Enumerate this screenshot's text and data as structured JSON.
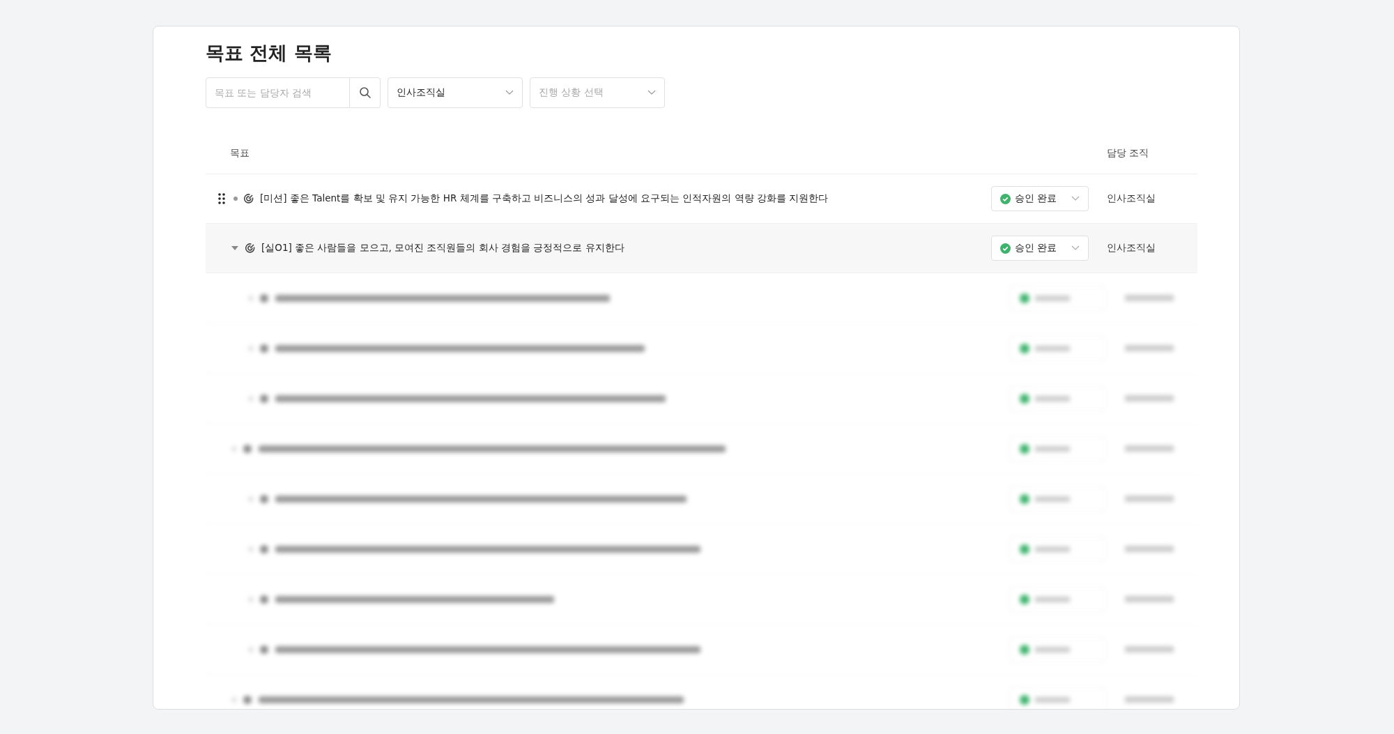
{
  "page": {
    "title": "목표 전체 목록"
  },
  "filters": {
    "search": {
      "placeholder": "목표 또는 담당자 검색"
    },
    "organization": {
      "value": "인사조직실"
    },
    "progress": {
      "placeholder": "진행 상황 선택"
    }
  },
  "table": {
    "columns": [
      "목표",
      "담당 조직"
    ],
    "rows": [
      {
        "kind": "mission",
        "title": "[미션] 좋은 Talent를 확보 및 유지 가능한 HR 체계를 구축하고 비즈니스의 성과 달성에 요구되는 인적자원의 역량 강화를 지원한다",
        "status": "승인 완료",
        "organization": "인사조직실",
        "selected": false
      },
      {
        "kind": "objective",
        "title": "[실O1] 좋은 사람들을 모으고, 모여진 조직원들의 회사 경험을 긍정적으로 유지한다",
        "status": "승인 완료",
        "organization": "인사조직실",
        "selected": true,
        "expanded": true
      }
    ]
  }
}
